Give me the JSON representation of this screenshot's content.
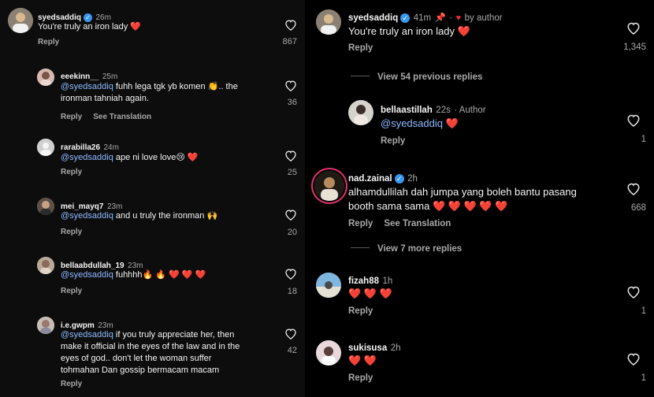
{
  "left": {
    "main_comment": {
      "username": "syedsaddiq",
      "time": "26m",
      "text": "You're truly an iron lady",
      "emoji": "❤️",
      "likes": "867",
      "reply": "Reply"
    },
    "replies": [
      {
        "username": "eeekinn__",
        "time": "25m",
        "mention": "@syedsaddiq",
        "text": "fuhh lega tgk yb komen 👏.. the",
        "text2": "ironman tahniah again.",
        "likes": "36",
        "reply": "Reply",
        "see_translation": "See Translation"
      },
      {
        "username": "rarabilla26",
        "time": "24m",
        "mention": "@syedsaddiq",
        "text": "ape ni love love😢 ❤️",
        "likes": "25",
        "reply": "Reply"
      },
      {
        "username": "mei_mayq7",
        "time": "23m",
        "mention": "@syedsaddiq",
        "text": "and u truly the ironman 🙌",
        "likes": "20",
        "reply": "Reply"
      },
      {
        "username": "bellaabdullah_19",
        "time": "23m",
        "mention": "@syedsaddiq",
        "text": "fuhhhh🔥 🔥 ❤️ ❤️ ❤️",
        "likes": "18",
        "reply": "Reply"
      },
      {
        "username": "i.e.gwpm",
        "time": "23m",
        "mention": "@syedsaddiq",
        "text": "if you truly appreciate her, then",
        "text2": "make it official in the eyes of the law and in the",
        "text3": "eyes of god.. don't let the woman suffer",
        "text4": "tohmahan Dan gossip bermacam macam",
        "likes": "42",
        "reply": "Reply"
      }
    ]
  },
  "right": {
    "main_comment": {
      "username": "syedsaddiq",
      "time": "41m",
      "by_author": "by author",
      "text": "You're truly an iron lady",
      "emoji": "❤️",
      "likes": "1,345",
      "reply": "Reply"
    },
    "view_previous": "View 54 previous replies",
    "reply1": {
      "username": "bellaastillah",
      "time": "22s",
      "author_tag": "· Author",
      "mention": "@syedsaddiq",
      "emoji": "❤️",
      "likes": "1",
      "reply": "Reply"
    },
    "comment2": {
      "username": "nad.zainal",
      "time": "2h",
      "text": "alhamdullilah dah jumpa yang boleh bantu pasang",
      "text2": "booth sama sama ❤️ ❤️ ❤️ ❤️ ❤️",
      "likes": "668",
      "reply": "Reply",
      "see_translation": "See Translation"
    },
    "view_more": "View 7 more replies",
    "reply2": {
      "username": "fizah88",
      "time": "1h",
      "text": "❤️ ❤️ ❤️",
      "likes": "1",
      "reply": "Reply"
    },
    "reply3": {
      "username": "sukisusa",
      "time": "2h",
      "text": "❤️ ❤️",
      "likes": "1",
      "reply": "Reply"
    }
  },
  "colors": {
    "background": "#000000",
    "text": "#f5f5f5",
    "muted": "#a8a8a8",
    "mention": "#8fb8ff",
    "heart": "#ed2a3d",
    "verified": "#3897f0"
  }
}
